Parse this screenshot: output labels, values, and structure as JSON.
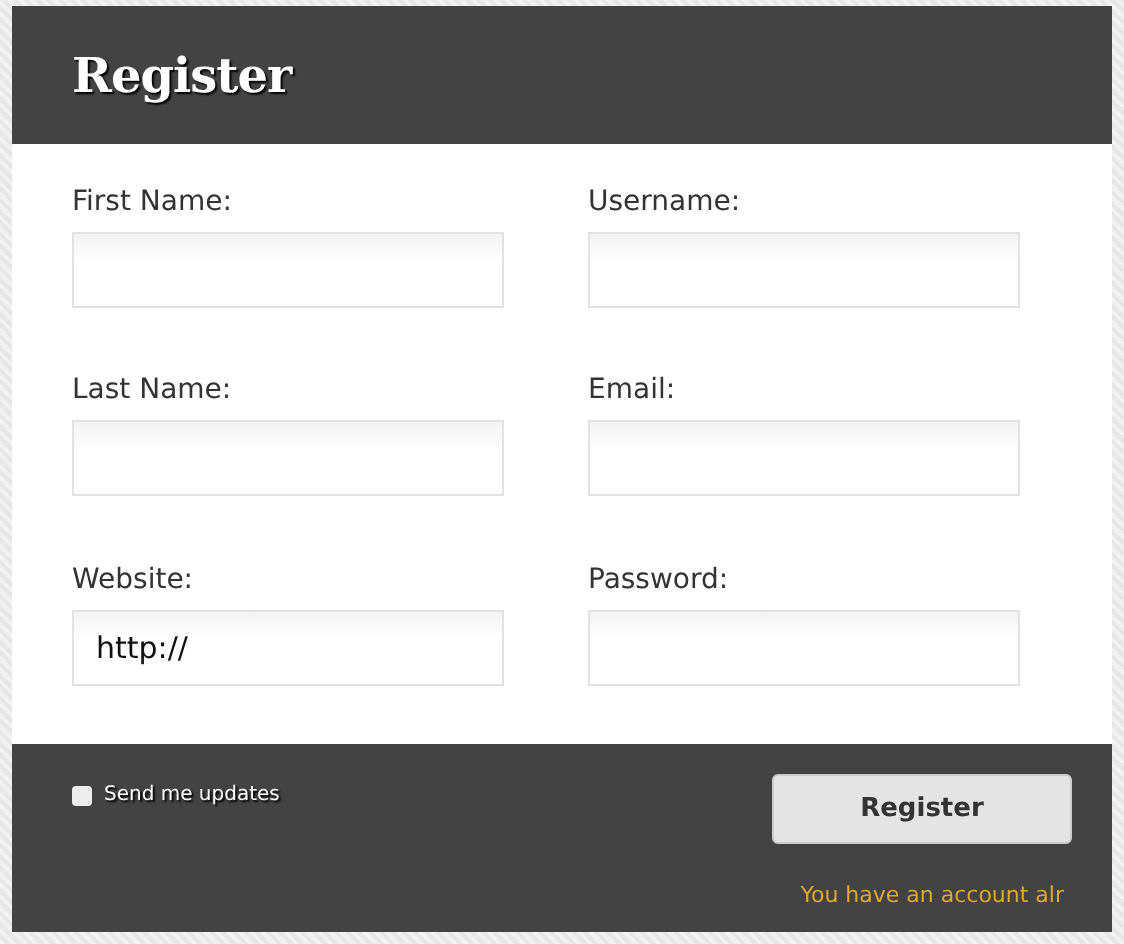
{
  "header": {
    "title": "Register"
  },
  "fields": [
    {
      "label": "First Name:"
    },
    {
      "label": "Username:"
    },
    {
      "label": "Last Name:"
    },
    {
      "label": "Email:"
    },
    {
      "label": "Website:",
      "value": "http://"
    },
    {
      "label": "Password:"
    }
  ],
  "footer": {
    "updates": {
      "label": "Send me updates",
      "checked": false
    },
    "button": "Register",
    "login_note": "You have an account alr"
  }
}
